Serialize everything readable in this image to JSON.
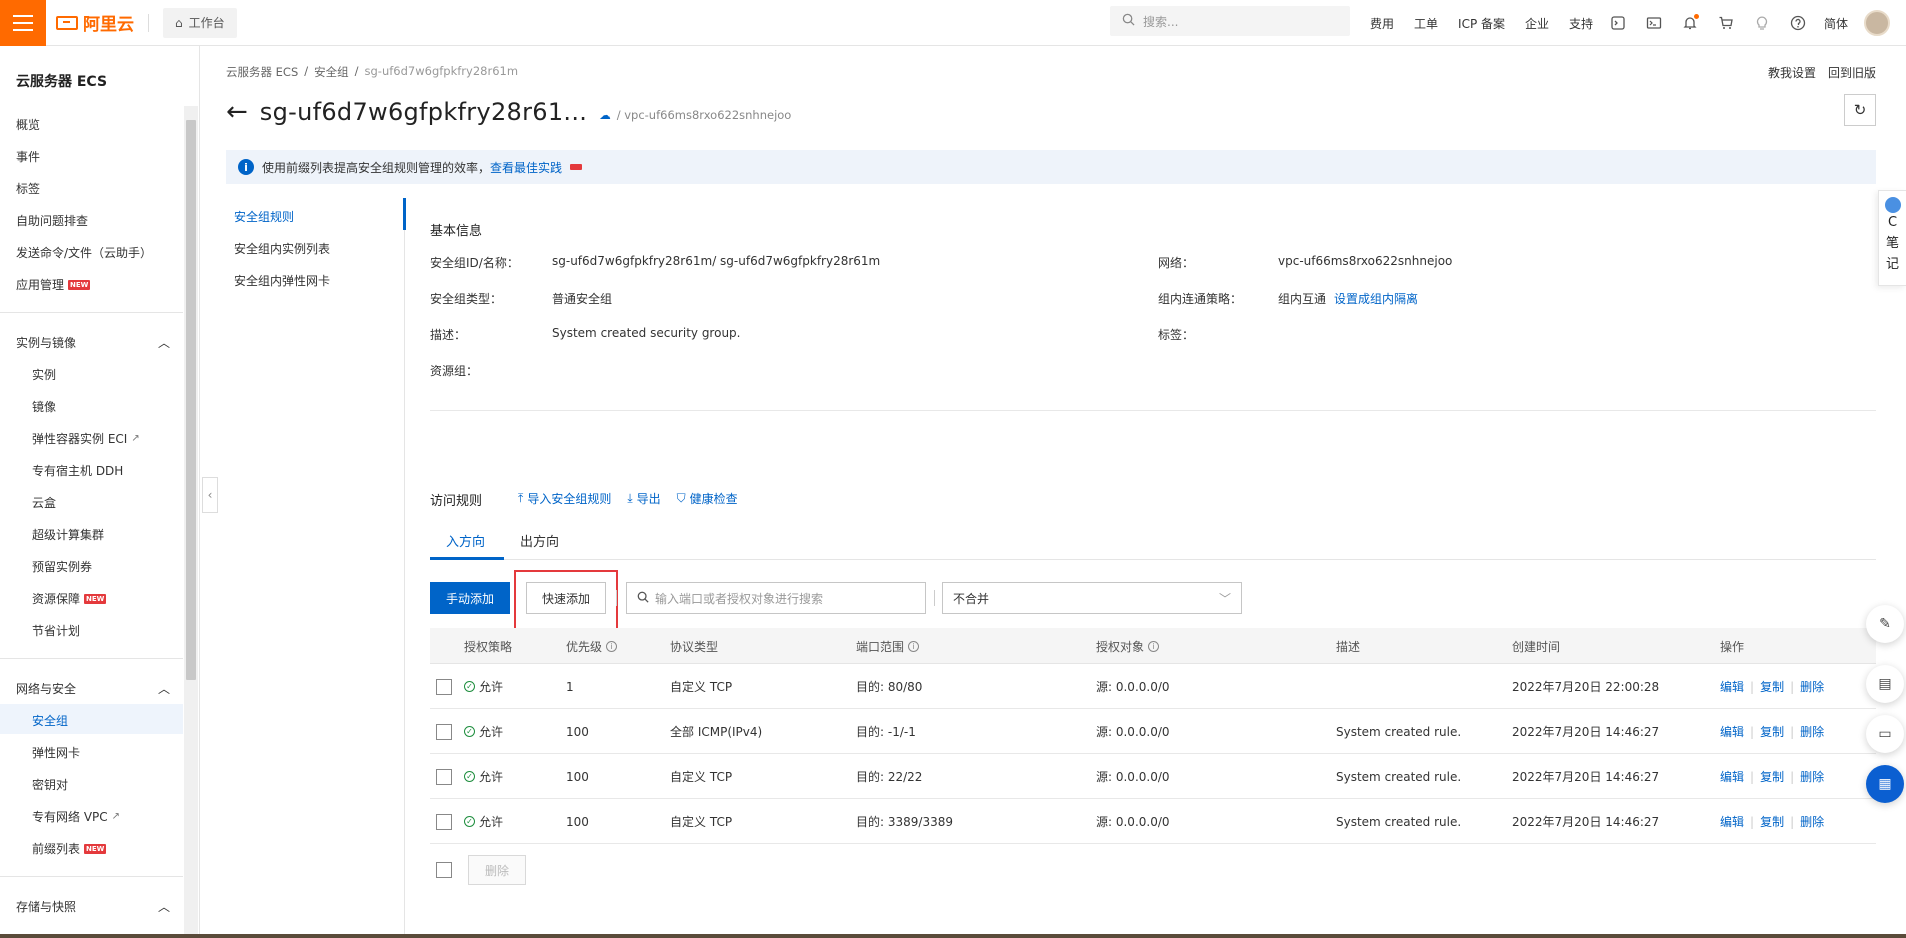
{
  "topbar": {
    "brand": "阿里云",
    "workbench": "工作台",
    "search_placeholder": "搜索...",
    "links": [
      "费用",
      "工单",
      "ICP 备案",
      "企业",
      "支持"
    ],
    "lang": "简体",
    "icons": [
      "terminal-icon",
      "console-icon",
      "bell-icon",
      "cart-icon",
      "bulb-icon",
      "help-icon"
    ]
  },
  "leftnav": {
    "title": "云服务器 ECS",
    "items_top": [
      "概览",
      "事件",
      "标签",
      "自助问题排查",
      "发送命令/文件（云助手）",
      "应用管理"
    ],
    "group1": {
      "label": "实例与镜像",
      "items": [
        "实例",
        "镜像",
        "弹性容器实例 ECI",
        "专有宿主机 DDH",
        "云盒",
        "超级计算集群",
        "预留实例券",
        "资源保障",
        "节省计划"
      ]
    },
    "group2": {
      "label": "网络与安全",
      "items": [
        "安全组",
        "弹性网卡",
        "密钥对",
        "专有网络 VPC",
        "前缀列表"
      ]
    },
    "group3": {
      "label": "存储与快照"
    },
    "new_badge": "NEW"
  },
  "main": {
    "breadcrumb": [
      "云服务器 ECS",
      "/",
      "安全组",
      "/",
      "sg-uf6d7w6gfpkfry28r61m"
    ],
    "top_right": [
      "教我设置",
      "回到旧版"
    ],
    "title": "sg-uf6d7w6gfpkfry28r61...",
    "vpc": "/ vpc-uf66ms8rxo622snhnejoo",
    "info_text": "使用前缀列表提高安全组规则管理的效率，",
    "info_link": "查看最佳实践",
    "inner_tabs": [
      "安全组规则",
      "安全组内实例列表",
      "安全组内弹性网卡"
    ],
    "basic": {
      "title": "基本信息",
      "id_label": "安全组ID/名称：",
      "id_value": "sg-uf6d7w6gfpkfry28r61m/ sg-uf6d7w6gfpkfry28r61m",
      "network_label": "网络：",
      "network_value": "vpc-uf66ms8rxo622snhnejoo",
      "type_label": "安全组类型：",
      "type_value": "普通安全组",
      "policy_label": "组内连通策略：",
      "policy_value": "组内互通",
      "policy_link": "设置成组内隔离",
      "desc_label": "描述：",
      "desc_value": "System created security group.",
      "tag_label": "标签：",
      "rg_label": "资源组："
    },
    "rules": {
      "title": "访问规则",
      "import": "导入安全组规则",
      "export": "导出",
      "health": "健康检查",
      "tab_in": "入方向",
      "tab_out": "出方向",
      "btn_manual": "手动添加",
      "btn_quick": "快速添加",
      "search_placeholder": "输入端口或者授权对象进行搜索",
      "merge_select": "不合并",
      "headers": [
        "授权策略",
        "优先级",
        "协议类型",
        "端口范围",
        "授权对象",
        "描述",
        "创建时间",
        "操作"
      ],
      "rows": [
        {
          "policy": "允许",
          "priority": "1",
          "protocol": "自定义 TCP",
          "port": "目的: 80/80",
          "target": "源: 0.0.0.0/0",
          "desc": "",
          "time": "2022年7月20日 22:00:28"
        },
        {
          "policy": "允许",
          "priority": "100",
          "protocol": "全部 ICMP(IPv4)",
          "port": "目的: -1/-1",
          "target": "源: 0.0.0.0/0",
          "desc": "System created rule.",
          "time": "2022年7月20日 14:46:27"
        },
        {
          "policy": "允许",
          "priority": "100",
          "protocol": "自定义 TCP",
          "port": "目的: 22/22",
          "target": "源: 0.0.0.0/0",
          "desc": "System created rule.",
          "time": "2022年7月20日 14:46:27"
        },
        {
          "policy": "允许",
          "priority": "100",
          "protocol": "自定义 TCP",
          "port": "目的: 3389/3389",
          "target": "源: 0.0.0.0/0",
          "desc": "System created rule.",
          "time": "2022年7月20日 14:46:27"
        }
      ],
      "ops": [
        "编辑",
        "复制",
        "删除"
      ],
      "delete_btn": "删除"
    },
    "side_note": [
      "C",
      "笔",
      "记"
    ]
  },
  "colors": {
    "brand": "#ff6a00",
    "accent": "#0064c8",
    "highlight": "#e4393c"
  }
}
